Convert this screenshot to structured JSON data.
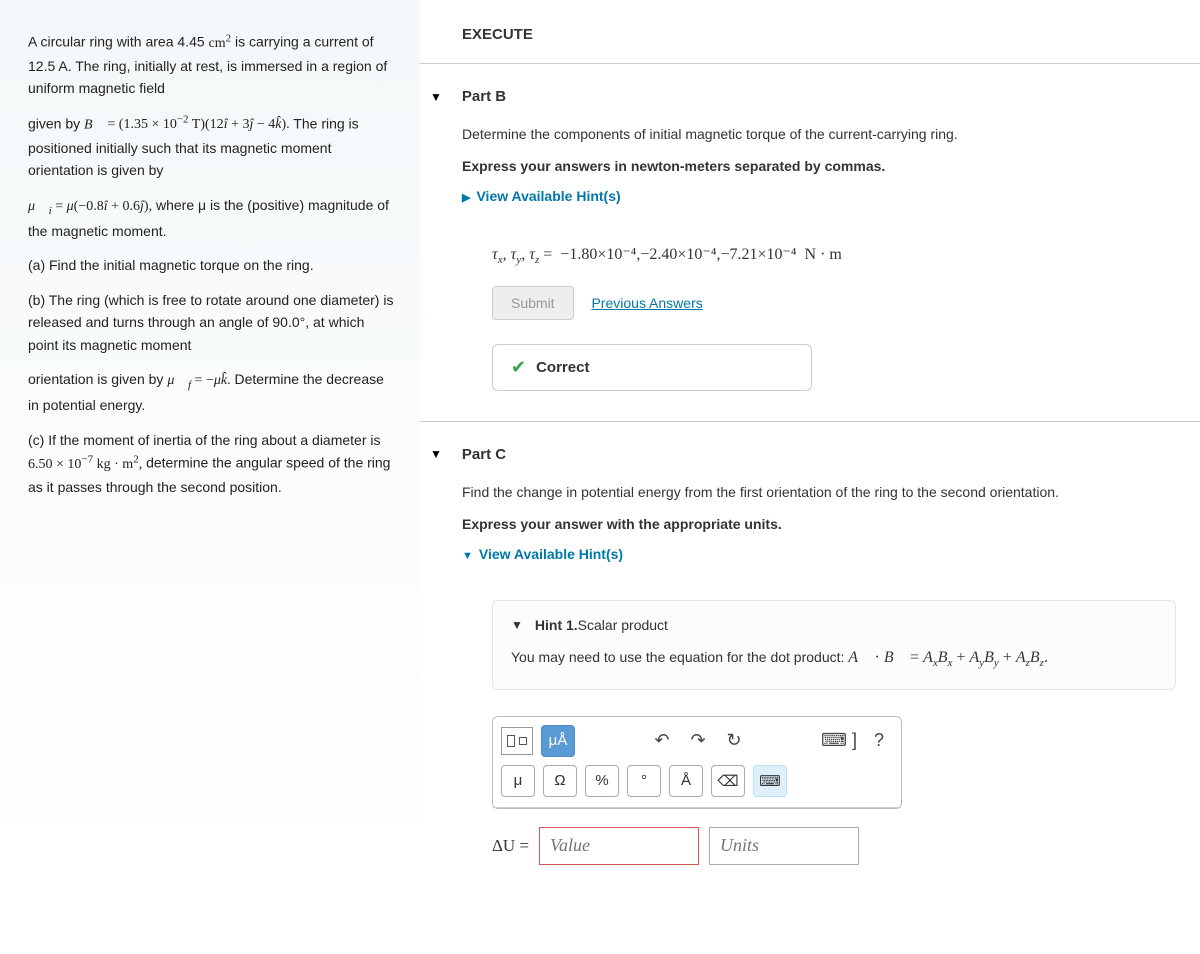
{
  "problem": {
    "p1a": "A circular ring with area 4.45 ",
    "p1b": " is carrying a current of 12.5 A. The ring, initially at rest, is immersed in a region of uniform magnetic field",
    "p2a": "given by ",
    "p2c": " The ring is positioned initially such that its magnetic moment orientation is given by",
    "p3b": " where μ is the (positive) magnitude of the magnetic moment.",
    "pa": "(a) Find the initial magnetic torque on the ring.",
    "pb": "(b) The ring (which is free to rotate around one diameter) is released and turns through an angle of 90.0°, at which point its magnetic moment",
    "pb2a": "orientation is given by ",
    "pb2c": " Determine the decrease in potential energy.",
    "pc": "(c) If the moment of inertia of the ring about a diameter is ",
    "pc2": " determine the angular speed of the ring as it passes through the second position."
  },
  "execute": "EXECUTE",
  "partB": {
    "title": "Part B",
    "prompt": "Determine the components of initial magnetic torque of the current-carrying ring.",
    "format": "Express your answers in newton-meters separated by commas.",
    "hint_link": "View Available Hint(s)",
    "answer_value": "−1.80×10⁻⁴,−2.40×10⁻⁴,−7.21×10⁻⁴",
    "units": "N · m",
    "submit": "Submit",
    "prev": "Previous Answers",
    "correct": "Correct"
  },
  "partC": {
    "title": "Part C",
    "prompt": "Find the change in potential energy from the first orientation of the ring to the second orientation.",
    "format": "Express your answer with the appropriate units.",
    "hint_link": "View Available Hint(s)",
    "hint1_label": "Hint 1.",
    "hint1_title": " Scalar product",
    "hint1_body_a": "You may need to use the equation for the dot product: ",
    "delta_label": "ΔU = ",
    "value_ph": "Value",
    "units_ph": "Units"
  },
  "toolbar": {
    "mu_a": "μÅ",
    "undo": "↶",
    "redo": "↷",
    "reset": "↻",
    "keyb": "⌨ ]",
    "help": "?",
    "mu": "μ",
    "omega": "Ω",
    "pct": "%",
    "deg": "°",
    "ang": "Å",
    "bksp": "⌫",
    "kbd2": "⌨"
  }
}
